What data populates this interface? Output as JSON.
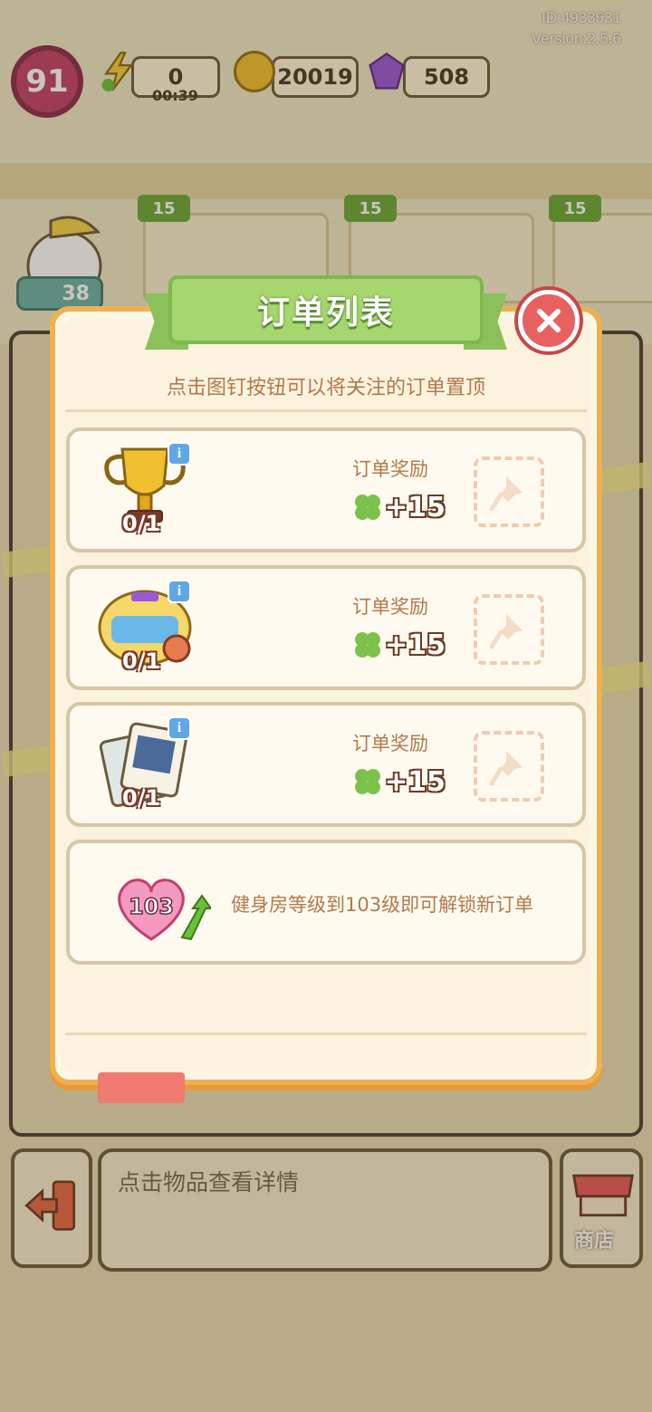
{
  "hud": {
    "player_level": "91",
    "energy_value": "0",
    "energy_timer": "00:39",
    "coins_value": "20019",
    "gems_value": "508",
    "account_id": "ID:4933631",
    "version": "Version:2.5.6",
    "order_reward_preview": [
      "15",
      "15",
      "15"
    ],
    "avatar_count": "38"
  },
  "bottom_bar": {
    "hint": "点击物品查看详情",
    "shop_label": "商店"
  },
  "modal": {
    "title": "订单列表",
    "subtitle": "点击图钉按钮可以将关注的订单置顶",
    "orders": [
      {
        "item_icon": "trophy-icon",
        "progress": "0/1",
        "reward_label": "订单奖励",
        "reward_value": "+15"
      },
      {
        "item_icon": "gym-sticker-icon",
        "progress": "0/1",
        "reward_label": "订单奖励",
        "reward_value": "+15"
      },
      {
        "item_icon": "photo-cards-icon",
        "progress": "0/1",
        "reward_label": "订单奖励",
        "reward_value": "+15"
      }
    ],
    "locked": {
      "level": "103",
      "text": "健身房等级到103级即可解锁新订单"
    }
  },
  "colors": {
    "ribbon_green": "#a6d66e",
    "modal_border": "#f0b050",
    "close_red": "#e86060",
    "text_brown": "#b07a4a"
  }
}
